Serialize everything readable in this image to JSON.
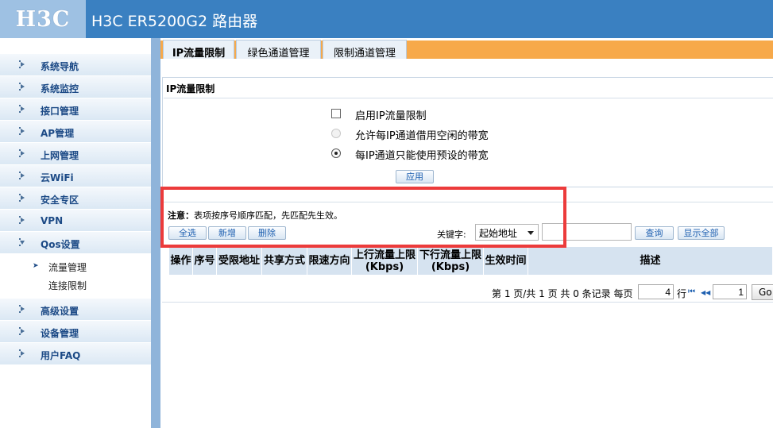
{
  "header": {
    "logo": "H3C",
    "title": "H3C ER5200G2 路由器"
  },
  "sidebar": {
    "items": [
      {
        "label": "系统导航"
      },
      {
        "label": "系统监控"
      },
      {
        "label": "接口管理"
      },
      {
        "label": "AP管理"
      },
      {
        "label": "上网管理"
      },
      {
        "label": "云WiFi"
      },
      {
        "label": "安全专区"
      },
      {
        "label": "VPN"
      },
      {
        "label": "Qos设置"
      },
      {
        "label": "高级设置"
      },
      {
        "label": "设备管理"
      },
      {
        "label": "用户FAQ"
      }
    ],
    "qos_sub": [
      {
        "label": "流量管理"
      },
      {
        "label": "连接限制"
      }
    ],
    "sub_bullet": "➤"
  },
  "tabs": [
    {
      "label": "IP流量限制"
    },
    {
      "label": "绿色通道管理"
    },
    {
      "label": "限制通道管理"
    }
  ],
  "panel": {
    "title": "IP流量限制",
    "enable_label": "启用IP流量限制",
    "enable_checked": false,
    "radio_borrow_label": "允许每IP通道借用空闲的带宽",
    "radio_preset_label": "每IP通道只能使用预设的带宽",
    "selected_radio": "preset",
    "apply_label": "应用"
  },
  "list": {
    "note_prefix": "注意：",
    "note_text": "表项按序号顺序匹配，先匹配先生效。",
    "select_all_label": "全选",
    "add_label": "新增",
    "delete_label": "删除",
    "keyword_label": "关键字:",
    "keyword_selected": "起始地址",
    "keyword_value": "",
    "search_label": "查询",
    "show_all_label": "显示全部",
    "columns": [
      {
        "label": "操作"
      },
      {
        "label": "序号"
      },
      {
        "label": "受限地址"
      },
      {
        "label": "共享方式"
      },
      {
        "label": "限速方向"
      },
      {
        "label": "上行流量上限 (Kbps)"
      },
      {
        "label": "下行流量上限 (Kbps)"
      },
      {
        "label": "生效时间"
      },
      {
        "label": "描述"
      }
    ]
  },
  "pager": {
    "summary": "第 1 页/共 1 页 共 0 条记录 每页",
    "per_page": "4",
    "row_unit": "行",
    "first_icon": "⏮",
    "prev_icon": "◀◀",
    "page_input": "1",
    "go_label": "Go"
  },
  "colors": {
    "header_blue": "#3a80c1",
    "tab_orange": "#f7a94a",
    "menu_text": "#1c4a86",
    "highlight_red": "#ec3b3b"
  }
}
